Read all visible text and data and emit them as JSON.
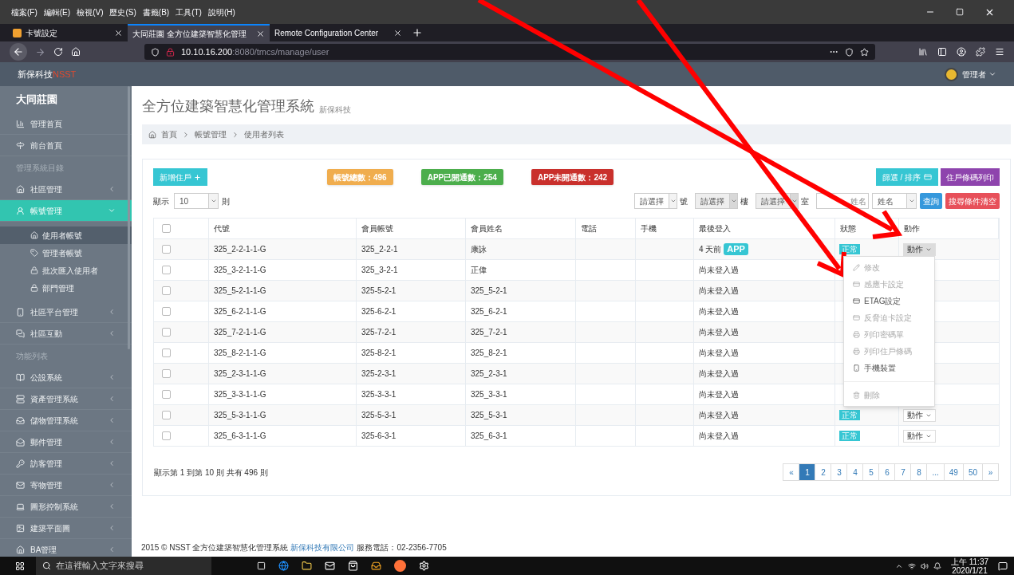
{
  "browser": {
    "menu": [
      "檔案(F)",
      "編輯(E)",
      "檢視(V)",
      "歷史(S)",
      "書籤(B)",
      "工具(T)",
      "說明(H)"
    ],
    "tabs": [
      {
        "title": "卡號設定",
        "selected": false
      },
      {
        "title": "大同莊園 全方位建築智慧化管理",
        "selected": true
      },
      {
        "title": "Remote Configuration Center",
        "selected": false
      }
    ],
    "url": {
      "host": "10.10.16.200",
      "path": ":8080/tmcs/manage/user"
    }
  },
  "header": {
    "brand": "新保科技",
    "brand_suffix": "NSST",
    "user": "管理者"
  },
  "sidebar": {
    "title": "大同莊園",
    "items": [
      {
        "kind": "link",
        "label": "管理首頁"
      },
      {
        "kind": "link",
        "label": "前台首頁"
      },
      {
        "kind": "heading",
        "label": "管理系統目錄"
      },
      {
        "kind": "group",
        "label": "社區管理",
        "selected": false,
        "expanded": false
      },
      {
        "kind": "group",
        "label": "帳號管理",
        "selected": true,
        "expanded": true,
        "children": [
          {
            "label": "使用者帳號",
            "selected": true
          },
          {
            "label": "管理者帳號",
            "selected": false
          },
          {
            "label": "批次匯入使用者",
            "selected": false
          },
          {
            "label": "部門管理",
            "selected": false
          }
        ]
      },
      {
        "kind": "group",
        "label": "社區平台管理",
        "selected": false,
        "expanded": false
      },
      {
        "kind": "group",
        "label": "社區互動",
        "selected": false,
        "expanded": false
      },
      {
        "kind": "heading",
        "label": "功能列表"
      },
      {
        "kind": "group",
        "label": "公設系統",
        "selected": false,
        "expanded": false
      },
      {
        "kind": "group",
        "label": "資產管理系統",
        "selected": false,
        "expanded": false
      },
      {
        "kind": "group",
        "label": "儲物管理系統",
        "selected": false,
        "expanded": false
      },
      {
        "kind": "group",
        "label": "郵件管理",
        "selected": false,
        "expanded": false
      },
      {
        "kind": "group",
        "label": "訪客管理",
        "selected": false,
        "expanded": false
      },
      {
        "kind": "group",
        "label": "寄物管理",
        "selected": false,
        "expanded": false
      },
      {
        "kind": "group",
        "label": "圖形控制系統",
        "selected": false,
        "expanded": false
      },
      {
        "kind": "group",
        "label": "建築平面圖",
        "selected": false,
        "expanded": false
      },
      {
        "kind": "group",
        "label": "BA管理",
        "selected": false,
        "expanded": false
      }
    ]
  },
  "page": {
    "title": "全方位建築智慧化管理系統",
    "subtitle": "新保科技",
    "breadcrumb": [
      "首頁",
      "帳號管理",
      "使用者列表"
    ]
  },
  "toolbar": {
    "add_button": "新增住戶",
    "stats": [
      {
        "label": "帳號總數：496",
        "color": "#f0ad4e"
      },
      {
        "label": "APP已開通數：254",
        "color": "#4cae4c"
      },
      {
        "label": "APP未開通數：242",
        "color": "#c9302c"
      }
    ],
    "filter_button": "篩選 / 排序",
    "print_button": "住戶條碼列印",
    "page_size": {
      "prefix": "顯示",
      "value": "10",
      "suffix": "則"
    },
    "filters": [
      {
        "value": "請選擇",
        "suffix": "號",
        "disabled": false
      },
      {
        "value": "請選擇",
        "suffix": "樓",
        "disabled": true
      },
      {
        "value": "請選擇",
        "suffix": "室",
        "disabled": true
      }
    ],
    "name_field": {
      "placeholder": "姓名"
    },
    "name_select": "姓名",
    "search_button": "查詢",
    "clear_button": "搜尋條件清空"
  },
  "table": {
    "header_checked": false,
    "columns": [
      "代號",
      "會員帳號",
      "會員姓名",
      "電話",
      "手機",
      "最後登入",
      "狀態",
      "動作"
    ],
    "rows": [
      {
        "checked": false,
        "code": "325_2-2-1-1-G",
        "account": "325_2-2-1",
        "name": "康詠",
        "last_login": "4 天前",
        "app_badge": "APP",
        "status": "正常",
        "action": "動作",
        "open": true
      },
      {
        "checked": false,
        "code": "325_3-2-1-1-G",
        "account": "325_3-2-1",
        "name": "正偉",
        "last_login": "尚未登入過"
      },
      {
        "checked": false,
        "code": "325_5-2-1-1-G",
        "account": "325-5-2-1",
        "name": "325_5-2-1",
        "last_login": "尚未登入過"
      },
      {
        "checked": false,
        "code": "325_6-2-1-1-G",
        "account": "325-6-2-1",
        "name": "325_6-2-1",
        "last_login": "尚未登入過"
      },
      {
        "checked": false,
        "code": "325_7-2-1-1-G",
        "account": "325-7-2-1",
        "name": "325_7-2-1",
        "last_login": "尚未登入過"
      },
      {
        "checked": false,
        "code": "325_8-2-1-1-G",
        "account": "325-8-2-1",
        "name": "325_8-2-1",
        "last_login": "尚未登入過"
      },
      {
        "checked": false,
        "code": "325_2-3-1-1-G",
        "account": "325-2-3-1",
        "name": "325_2-3-1",
        "last_login": "尚未登入過"
      },
      {
        "checked": false,
        "code": "325_3-3-1-1-G",
        "account": "325-3-3-1",
        "name": "325_3-3-1",
        "last_login": "尚未登入過"
      },
      {
        "checked": false,
        "code": "325_5-3-1-1-G",
        "account": "325-5-3-1",
        "name": "325_5-3-1",
        "last_login": "尚未登入過",
        "status": "正常",
        "action": "動作",
        "open": false
      },
      {
        "checked": false,
        "code": "325_6-3-1-1-G",
        "account": "325-6-3-1",
        "name": "325_6-3-1",
        "last_login": "尚未登入過",
        "status": "正常",
        "action": "動作",
        "open": false
      }
    ]
  },
  "action_menu": [
    {
      "kind": "item",
      "label": "修改",
      "disabled": true
    },
    {
      "kind": "item",
      "label": "感應卡設定",
      "disabled": true
    },
    {
      "kind": "item",
      "label": "ETAG設定",
      "disabled": false
    },
    {
      "kind": "item",
      "label": "反脅迫卡設定",
      "disabled": true
    },
    {
      "kind": "item",
      "label": "列印密碼單",
      "disabled": true
    },
    {
      "kind": "item",
      "label": "列印住戶條碼",
      "disabled": true
    },
    {
      "kind": "item",
      "label": "手機裝置",
      "disabled": false
    },
    {
      "kind": "divider"
    },
    {
      "kind": "item",
      "label": "刪除",
      "disabled": true
    }
  ],
  "pagination": {
    "info": "顯示第 1 到第 10 則 共有 496 則",
    "pages": [
      {
        "label": "«",
        "selected": false
      },
      {
        "label": "1",
        "selected": true
      },
      {
        "label": "2",
        "selected": false
      },
      {
        "label": "3",
        "selected": false
      },
      {
        "label": "4",
        "selected": false
      },
      {
        "label": "5",
        "selected": false
      },
      {
        "label": "6",
        "selected": false
      },
      {
        "label": "7",
        "selected": false
      },
      {
        "label": "8",
        "selected": false
      },
      {
        "label": "...",
        "selected": false
      },
      {
        "label": "49",
        "selected": false
      },
      {
        "label": "50",
        "selected": false
      },
      {
        "label": "»",
        "selected": false
      }
    ]
  },
  "footer": {
    "text": "2015 © NSST 全方位建築智慧化管理系統",
    "link": "新保科技有限公司",
    "phone": "服務電話：02-2356-7705"
  },
  "taskbar": {
    "search_placeholder": "在這裡輸入文字來搜尋",
    "time": "上午 11:37",
    "date": "2020/1/21"
  }
}
